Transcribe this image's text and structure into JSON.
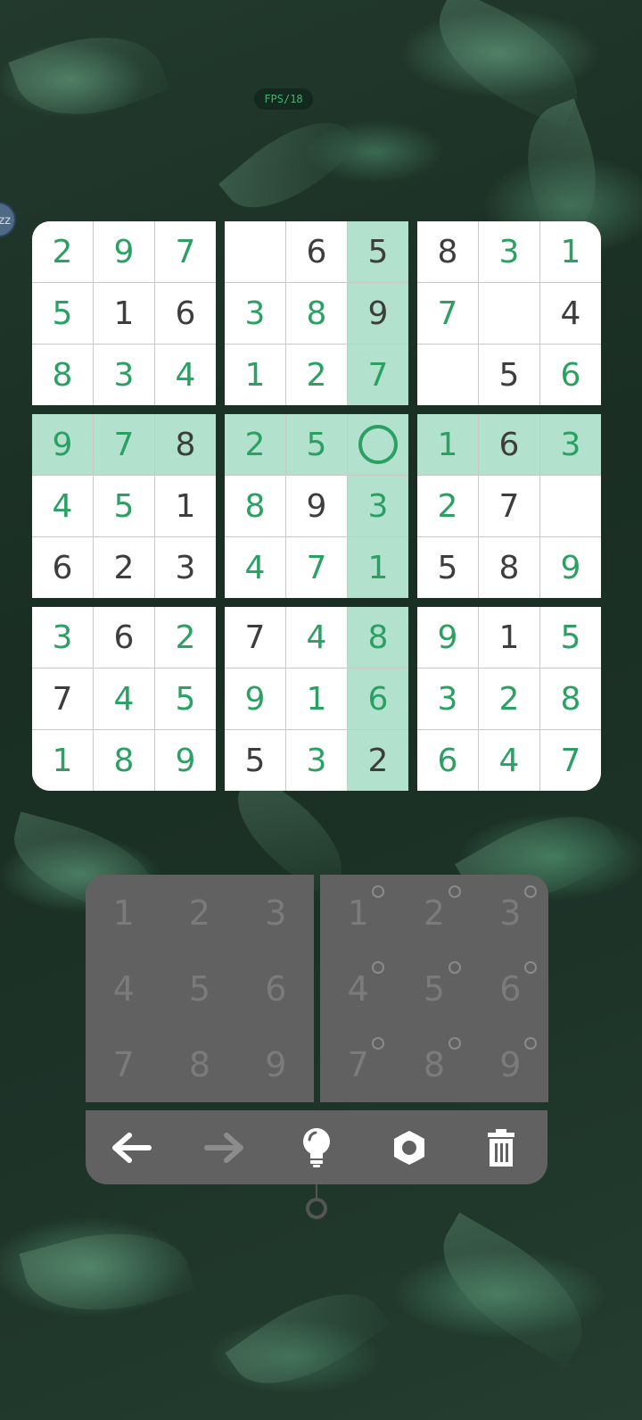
{
  "fps_label": "FPS/18",
  "bubble_label": "zz",
  "colors": {
    "given": "#3d3d3d",
    "user": "#2aa063",
    "highlight": "#b2e2cd",
    "panel": "#616161"
  },
  "board": {
    "rows": [
      [
        "2",
        "9",
        "7",
        "",
        "6",
        "5",
        "8",
        "3",
        "1"
      ],
      [
        "5",
        "1",
        "6",
        "3",
        "8",
        "9",
        "7",
        "",
        "4"
      ],
      [
        "8",
        "3",
        "4",
        "1",
        "2",
        "7",
        "",
        "5",
        "6"
      ],
      [
        "9",
        "7",
        "8",
        "2",
        "5",
        "",
        "1",
        "6",
        "3"
      ],
      [
        "4",
        "5",
        "1",
        "8",
        "9",
        "3",
        "2",
        "7",
        ""
      ],
      [
        "6",
        "2",
        "3",
        "4",
        "7",
        "1",
        "5",
        "8",
        "9"
      ],
      [
        "3",
        "6",
        "2",
        "7",
        "4",
        "8",
        "9",
        "1",
        "5"
      ],
      [
        "7",
        "4",
        "5",
        "9",
        "1",
        "6",
        "3",
        "2",
        "8"
      ],
      [
        "1",
        "8",
        "9",
        "5",
        "3",
        "2",
        "6",
        "4",
        "7"
      ]
    ],
    "user_entered": [
      [
        1,
        1,
        1,
        0,
        0,
        0,
        0,
        1,
        1
      ],
      [
        1,
        0,
        0,
        1,
        1,
        0,
        1,
        0,
        0
      ],
      [
        1,
        1,
        1,
        1,
        1,
        1,
        0,
        0,
        1
      ],
      [
        1,
        1,
        0,
        1,
        1,
        0,
        1,
        0,
        1
      ],
      [
        1,
        1,
        0,
        1,
        0,
        1,
        1,
        0,
        0
      ],
      [
        0,
        0,
        0,
        1,
        1,
        1,
        0,
        0,
        1
      ],
      [
        1,
        0,
        1,
        0,
        1,
        1,
        1,
        0,
        1
      ],
      [
        0,
        1,
        1,
        1,
        1,
        1,
        1,
        1,
        1
      ],
      [
        1,
        1,
        1,
        0,
        1,
        0,
        1,
        1,
        1
      ]
    ],
    "selected_cell": {
      "row": 3,
      "col": 5
    }
  },
  "number_pad": {
    "values": [
      "1",
      "2",
      "3",
      "4",
      "5",
      "6",
      "7",
      "8",
      "9"
    ]
  },
  "notes_pad": {
    "values": [
      "1",
      "2",
      "3",
      "4",
      "5",
      "6",
      "7",
      "8",
      "9"
    ]
  },
  "toolbar": {
    "undo_icon": "arrow-left-icon",
    "redo_icon": "arrow-right-icon",
    "hint_icon": "lightbulb-icon",
    "settings_icon": "gear-icon",
    "delete_icon": "trash-icon"
  }
}
